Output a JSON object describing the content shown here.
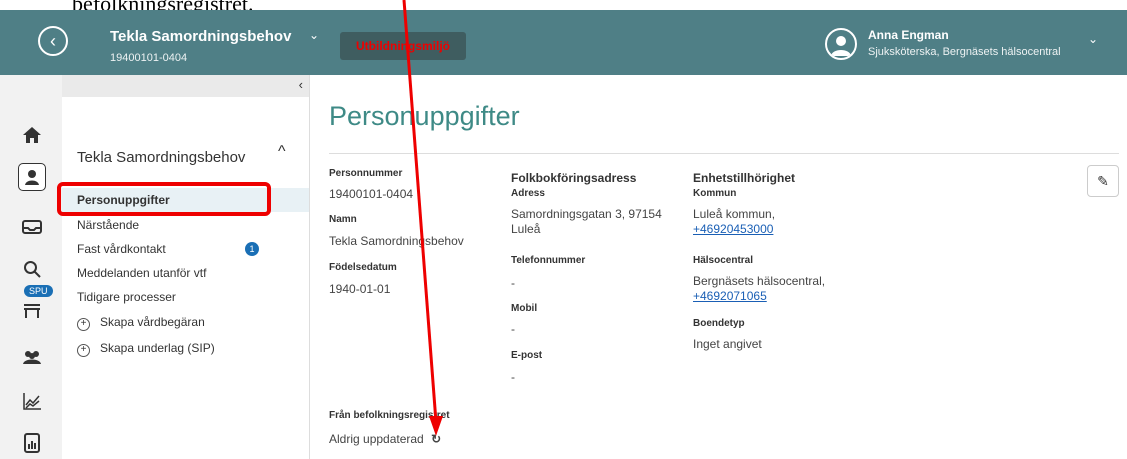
{
  "caption": "befolkningsregistret.",
  "header": {
    "patient_name": "Tekla Samordningsbehov",
    "patient_id": "19400101-0404",
    "env_badge": "Utbildningsmiljö",
    "user_name": "Anna Engman",
    "user_role": "Sjuksköterska, Bergnäsets hälsocentral"
  },
  "rail": {
    "spu_badge": "SPU"
  },
  "subnav": {
    "title": "Tekla Samordningsbehov",
    "items": [
      {
        "label": "Personuppgifter"
      },
      {
        "label": "Närstående"
      },
      {
        "label": "Fast vårdkontakt",
        "badge": "1"
      },
      {
        "label": "Meddelanden utanför vtf"
      },
      {
        "label": "Tidigare processer"
      },
      {
        "label": "Skapa vårdbegäran"
      },
      {
        "label": "Skapa underlag (SIP)"
      }
    ]
  },
  "main": {
    "title": "Personuppgifter",
    "col1": {
      "personnummer_label": "Personnummer",
      "personnummer_value": "19400101-0404",
      "namn_label": "Namn",
      "namn_value": "Tekla Samordningsbehov",
      "fodelsedatum_label": "Födelsedatum",
      "fodelsedatum_value": "1940-01-01"
    },
    "col2": {
      "heading": "Folkbokföringsadress",
      "adress_label": "Adress",
      "adress_line1": "Samordningsgatan 3, 97154",
      "adress_line2": "Luleå",
      "telefon_label": "Telefonnummer",
      "telefon_value": "-",
      "mobil_label": "Mobil",
      "mobil_value": "-",
      "epost_label": "E-post",
      "epost_value": "-"
    },
    "col3": {
      "heading": "Enhetstillhörighet",
      "kommun_label": "Kommun",
      "kommun_value": "Luleå kommun,",
      "kommun_phone": "+46920453000",
      "halsocentral_label": "Hälsocentral",
      "halsocentral_value": "Bergnäsets hälsocentral,",
      "halsocentral_phone": "+4692071065",
      "boendetyp_label": "Boendetyp",
      "boendetyp_value": "Inget angivet"
    },
    "registry_label": "Från befolkningsregistret",
    "registry_value": "Aldrig uppdaterad"
  },
  "colors": {
    "header_bg": "#4f7f86",
    "accent_title": "#3e8a86",
    "annotation_red": "#e00000",
    "badge_blue": "#1a6fb5"
  }
}
